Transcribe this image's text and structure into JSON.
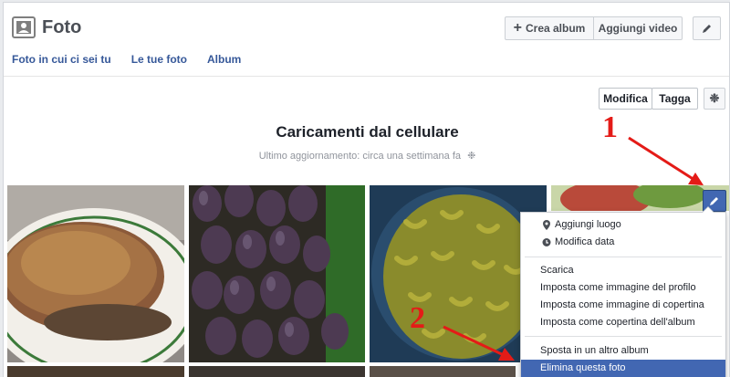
{
  "header": {
    "title": "Foto",
    "create_album": "Crea album",
    "add_video": "Aggiungi video",
    "tabs": [
      "Foto in cui ci sei tu",
      "Le tue foto",
      "Album"
    ]
  },
  "album": {
    "edit_label": "Modifica",
    "tag_label": "Tagga",
    "title": "Caricamenti dal cellulare",
    "meta": "Ultimo aggiornamento: circa una settimana fa"
  },
  "menu": {
    "items": [
      "Aggiungi luogo",
      "Modifica data",
      "Scarica",
      "Imposta come immagine del profilo",
      "Imposta come immagine di copertina",
      "Imposta come copertina dell'album",
      "Sposta in un altro album",
      "Elimina questa foto"
    ]
  },
  "annotations": [
    "1",
    "2"
  ],
  "colors": {
    "accent": "#4267b2",
    "annotation": "#e41b17",
    "link": "#365899"
  }
}
